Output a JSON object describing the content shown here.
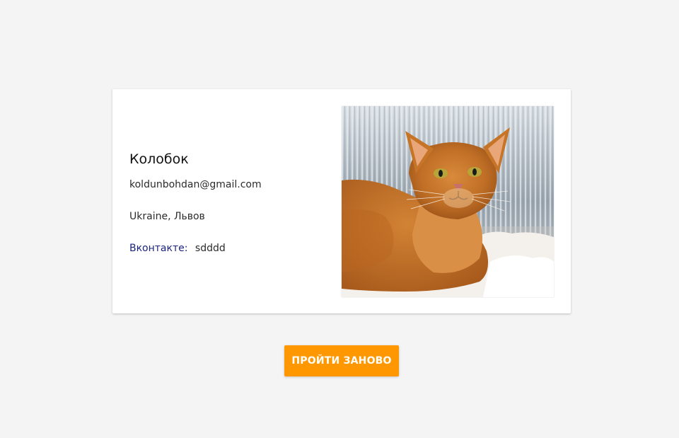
{
  "profile": {
    "name": "Колобок",
    "email": "koldunbohdan@gmail.com",
    "location": "Ukraine, Львов",
    "social_label": "Вконтакте:",
    "social_value": "sdddd"
  },
  "photo": {
    "subject": "cat-photo"
  },
  "actions": {
    "restart_label": "ПРОЙТИ ЗАНОВО"
  },
  "colors": {
    "background": "#f4f4f4",
    "card": "#ffffff",
    "accent_button": "#ff9800",
    "link": "#1a237e"
  }
}
